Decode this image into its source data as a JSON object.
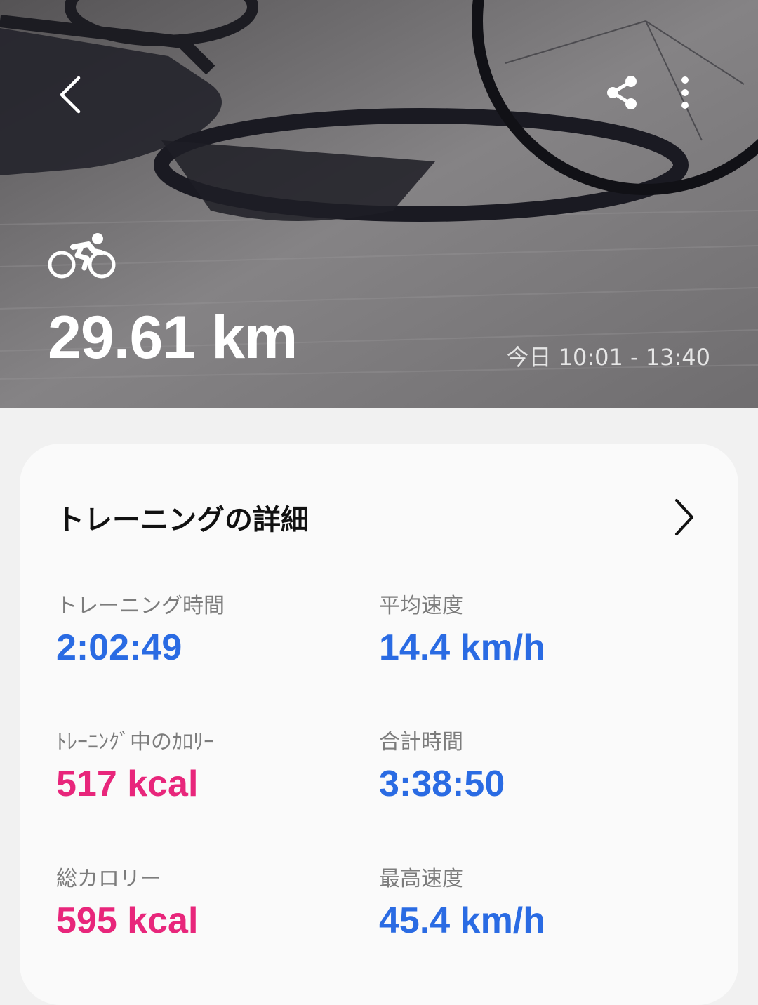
{
  "hero": {
    "distance": "29.61 km",
    "time_range": "今日 10:01 - 13:40",
    "activity_icon": "cycling-icon"
  },
  "toolbar": {
    "back_icon": "chevron-left-icon",
    "share_icon": "share-icon",
    "more_icon": "more-vertical-icon"
  },
  "details": {
    "title": "トレーニングの詳細",
    "stats": [
      {
        "label": "トレーニング時間",
        "value": "2:02:49"
      },
      {
        "label": "平均速度",
        "value": "14.4 km/h"
      },
      {
        "label": "ﾄﾚｰﾆﾝｸﾞ中のｶﾛﾘｰ",
        "value": "517 kcal"
      },
      {
        "label": "合計時間",
        "value": "3:38:50"
      },
      {
        "label": "総カロリー",
        "value": "595 kcal"
      },
      {
        "label": "最高速度",
        "value": "45.4 km/h"
      }
    ]
  },
  "colors": {
    "time_value": "#2a6be3",
    "calorie_value": "#e8267b"
  }
}
